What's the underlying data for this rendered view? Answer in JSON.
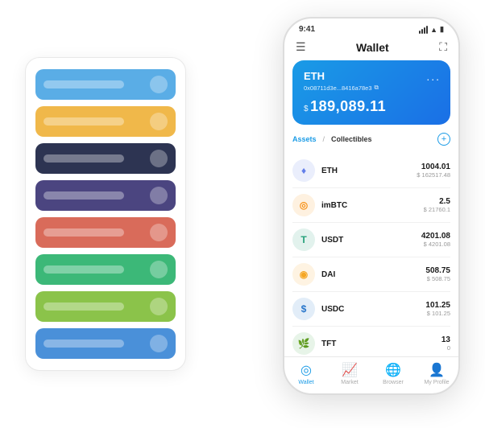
{
  "scene": {
    "cardStack": {
      "items": [
        {
          "color": "#5aade6",
          "textColor": "rgba(255,255,255,0.4)"
        },
        {
          "color": "#f0b84a",
          "textColor": "rgba(255,255,255,0.4)"
        },
        {
          "color": "#2d3452",
          "textColor": "rgba(255,255,255,0.4)"
        },
        {
          "color": "#4b4580",
          "textColor": "rgba(255,255,255,0.4)"
        },
        {
          "color": "#d96b5a",
          "textColor": "rgba(255,255,255,0.4)"
        },
        {
          "color": "#3cb878",
          "textColor": "rgba(255,255,255,0.4)"
        },
        {
          "color": "#8bc34a",
          "textColor": "rgba(255,255,255,0.4)"
        },
        {
          "color": "#4a90d9",
          "textColor": "rgba(255,255,255,0.4)"
        }
      ]
    },
    "phone": {
      "statusBar": {
        "time": "9:41",
        "icons": "●●●"
      },
      "header": {
        "menuIcon": "☰",
        "title": "Wallet",
        "expandIcon": "⛶"
      },
      "heroCard": {
        "ticker": "ETH",
        "address": "0x08711d3e...8416a78e3",
        "copyIcon": "⧉",
        "moreIcon": "...",
        "dollarSign": "$",
        "balance": "189,089.11"
      },
      "assets": {
        "activeTab": "Assets",
        "separator": "/",
        "inactiveTab": "Collectibles",
        "addIcon": "+"
      },
      "assetList": [
        {
          "name": "ETH",
          "icon": "♦",
          "iconBg": "#627eea22",
          "iconColor": "#627eea",
          "amount": "1004.01",
          "usd": "$ 162517.48"
        },
        {
          "name": "imBTC",
          "icon": "◎",
          "iconBg": "#f7931a22",
          "iconColor": "#f7931a",
          "amount": "2.5",
          "usd": "$ 21760.1"
        },
        {
          "name": "USDT",
          "icon": "T",
          "iconBg": "#26a17b22",
          "iconColor": "#26a17b",
          "amount": "4201.08",
          "usd": "$ 4201.08"
        },
        {
          "name": "DAI",
          "icon": "◉",
          "iconBg": "#f5a62322",
          "iconColor": "#f5a623",
          "amount": "508.75",
          "usd": "$ 508.75"
        },
        {
          "name": "USDC",
          "icon": "$",
          "iconBg": "#2775ca22",
          "iconColor": "#2775ca",
          "amount": "101.25",
          "usd": "$ 101.25"
        },
        {
          "name": "TFT",
          "icon": "🌿",
          "iconBg": "#4caf5022",
          "iconColor": "#4caf50",
          "amount": "13",
          "usd": "0"
        }
      ],
      "bottomNav": [
        {
          "icon": "◎",
          "label": "Wallet",
          "active": true
        },
        {
          "icon": "📈",
          "label": "Market",
          "active": false
        },
        {
          "icon": "🌐",
          "label": "Browser",
          "active": false
        },
        {
          "icon": "👤",
          "label": "My Profile",
          "active": false
        }
      ]
    }
  }
}
